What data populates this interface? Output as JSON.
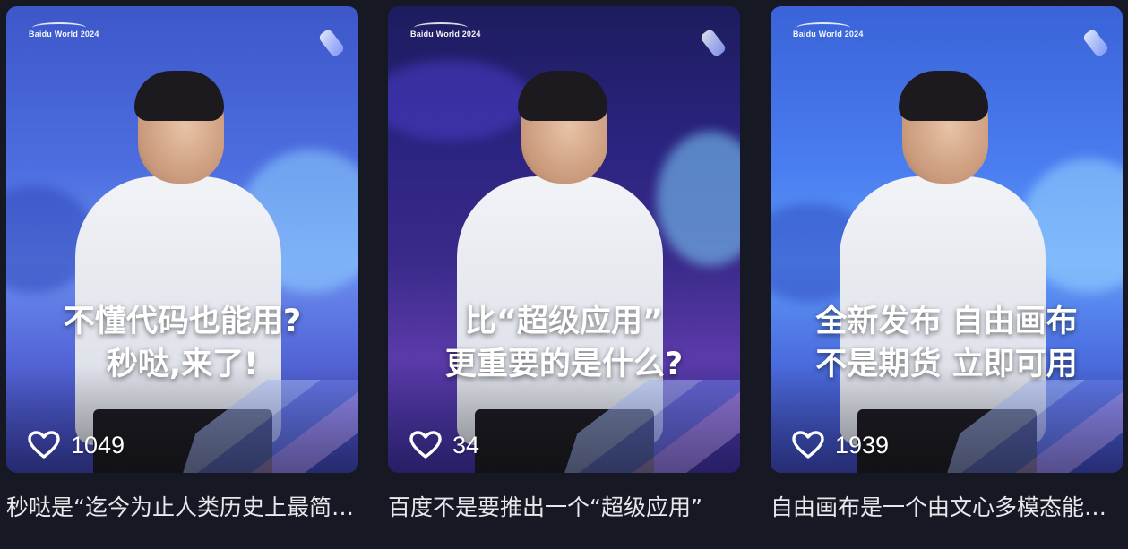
{
  "cards": [
    {
      "brand": "Baidu World 2024",
      "overlay_line1": "不懂代码也能用?",
      "overlay_line2": "秒哒,来了!",
      "likes": "1049",
      "caption": "秒哒是“迄今为止人类历史上最简单的编程工具”"
    },
    {
      "brand": "Baidu World 2024",
      "overlay_line1": "比“超级应用”",
      "overlay_line2": "更重要的是什么?",
      "likes": "34",
      "caption": "百度不是要推出一个“超级应用”"
    },
    {
      "brand": "Baidu World 2024",
      "overlay_line1": "全新发布 自由画布",
      "overlay_line2": "不是期货 立即可用",
      "likes": "1939",
      "caption": "自由画布是一个由文心多模态能力驱动的创作工具"
    }
  ],
  "icons": {
    "like": "heart-outline-icon",
    "deco": "crystal-icon"
  },
  "colors": {
    "page_bg": "#161823",
    "caption_text": "#e7e8ec",
    "overlay_text": "#ffffff"
  }
}
